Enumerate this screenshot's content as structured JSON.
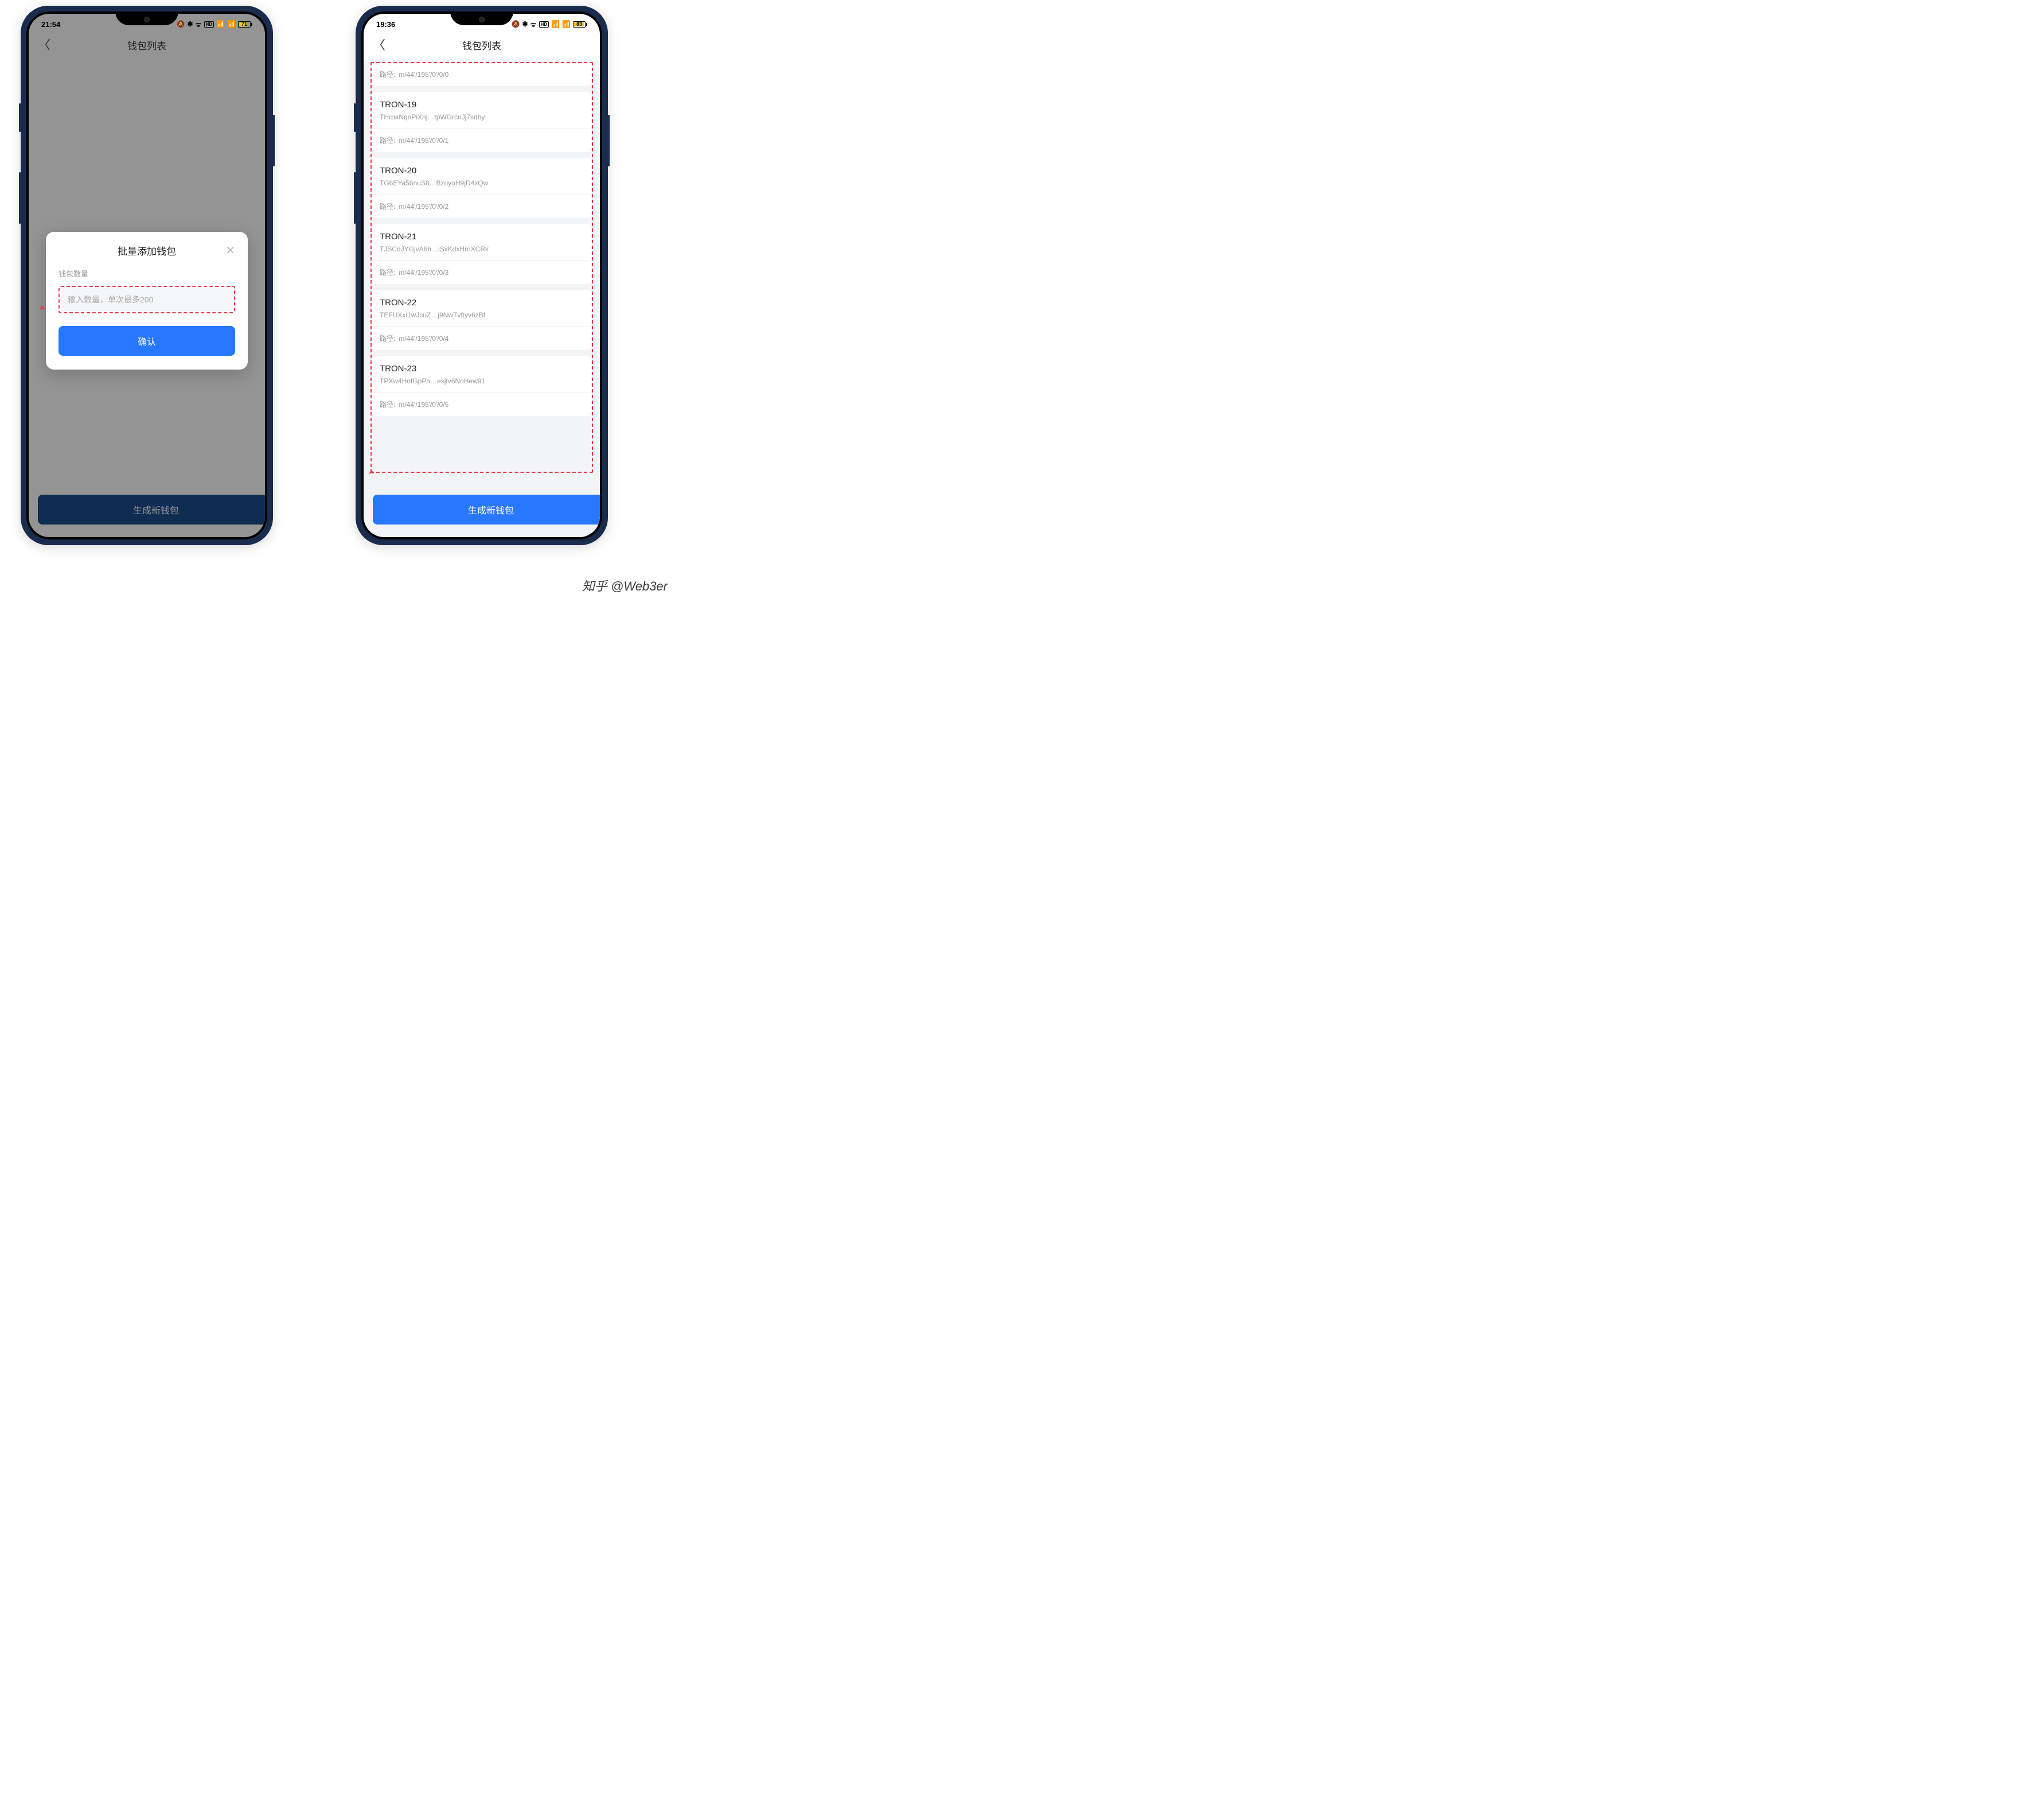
{
  "watermark": "知乎 @Web3er",
  "left": {
    "status": {
      "time": "21:54",
      "battery": 71
    },
    "header_title": "钱包列表",
    "modal": {
      "title": "批量添加钱包",
      "label": "钱包数量",
      "placeholder": "输入数量，单次最多200",
      "confirm": "确认"
    },
    "bottom_button": "生成新钱包"
  },
  "right": {
    "status": {
      "time": "19:36",
      "battery": 83
    },
    "header_title": "钱包列表",
    "bottom_button": "生成新钱包",
    "path_label": "路径:",
    "wallets": [
      {
        "name": "",
        "addr": "",
        "path": "m/44'/195'/0'/0/0",
        "path_only": true
      },
      {
        "name": "TRON-19",
        "addr": "THrbaNqnPiXhj…tpWGrcnJj7sdhy",
        "path": "m/44'/195'/0'/0/1"
      },
      {
        "name": "TRON-20",
        "addr": "TG6EYa56nuS8…BzuyoH9jD4xQw",
        "path": "m/44'/195'/0'/0/2"
      },
      {
        "name": "TRON-21",
        "addr": "TJSCdJYGjvA6h…iSxKdxHroXCRk",
        "path": "m/44'/195'/0'/0/3"
      },
      {
        "name": "TRON-22",
        "addr": "TEFUXxi1wJcuZ…j9NwTvftyv6zBf",
        "path": "m/44'/195'/0'/0/4"
      },
      {
        "name": "TRON-23",
        "addr": "TPXw4HofGpPn…esjtv6NoHew91",
        "path": "m/44'/195'/0'/0/5"
      }
    ]
  }
}
